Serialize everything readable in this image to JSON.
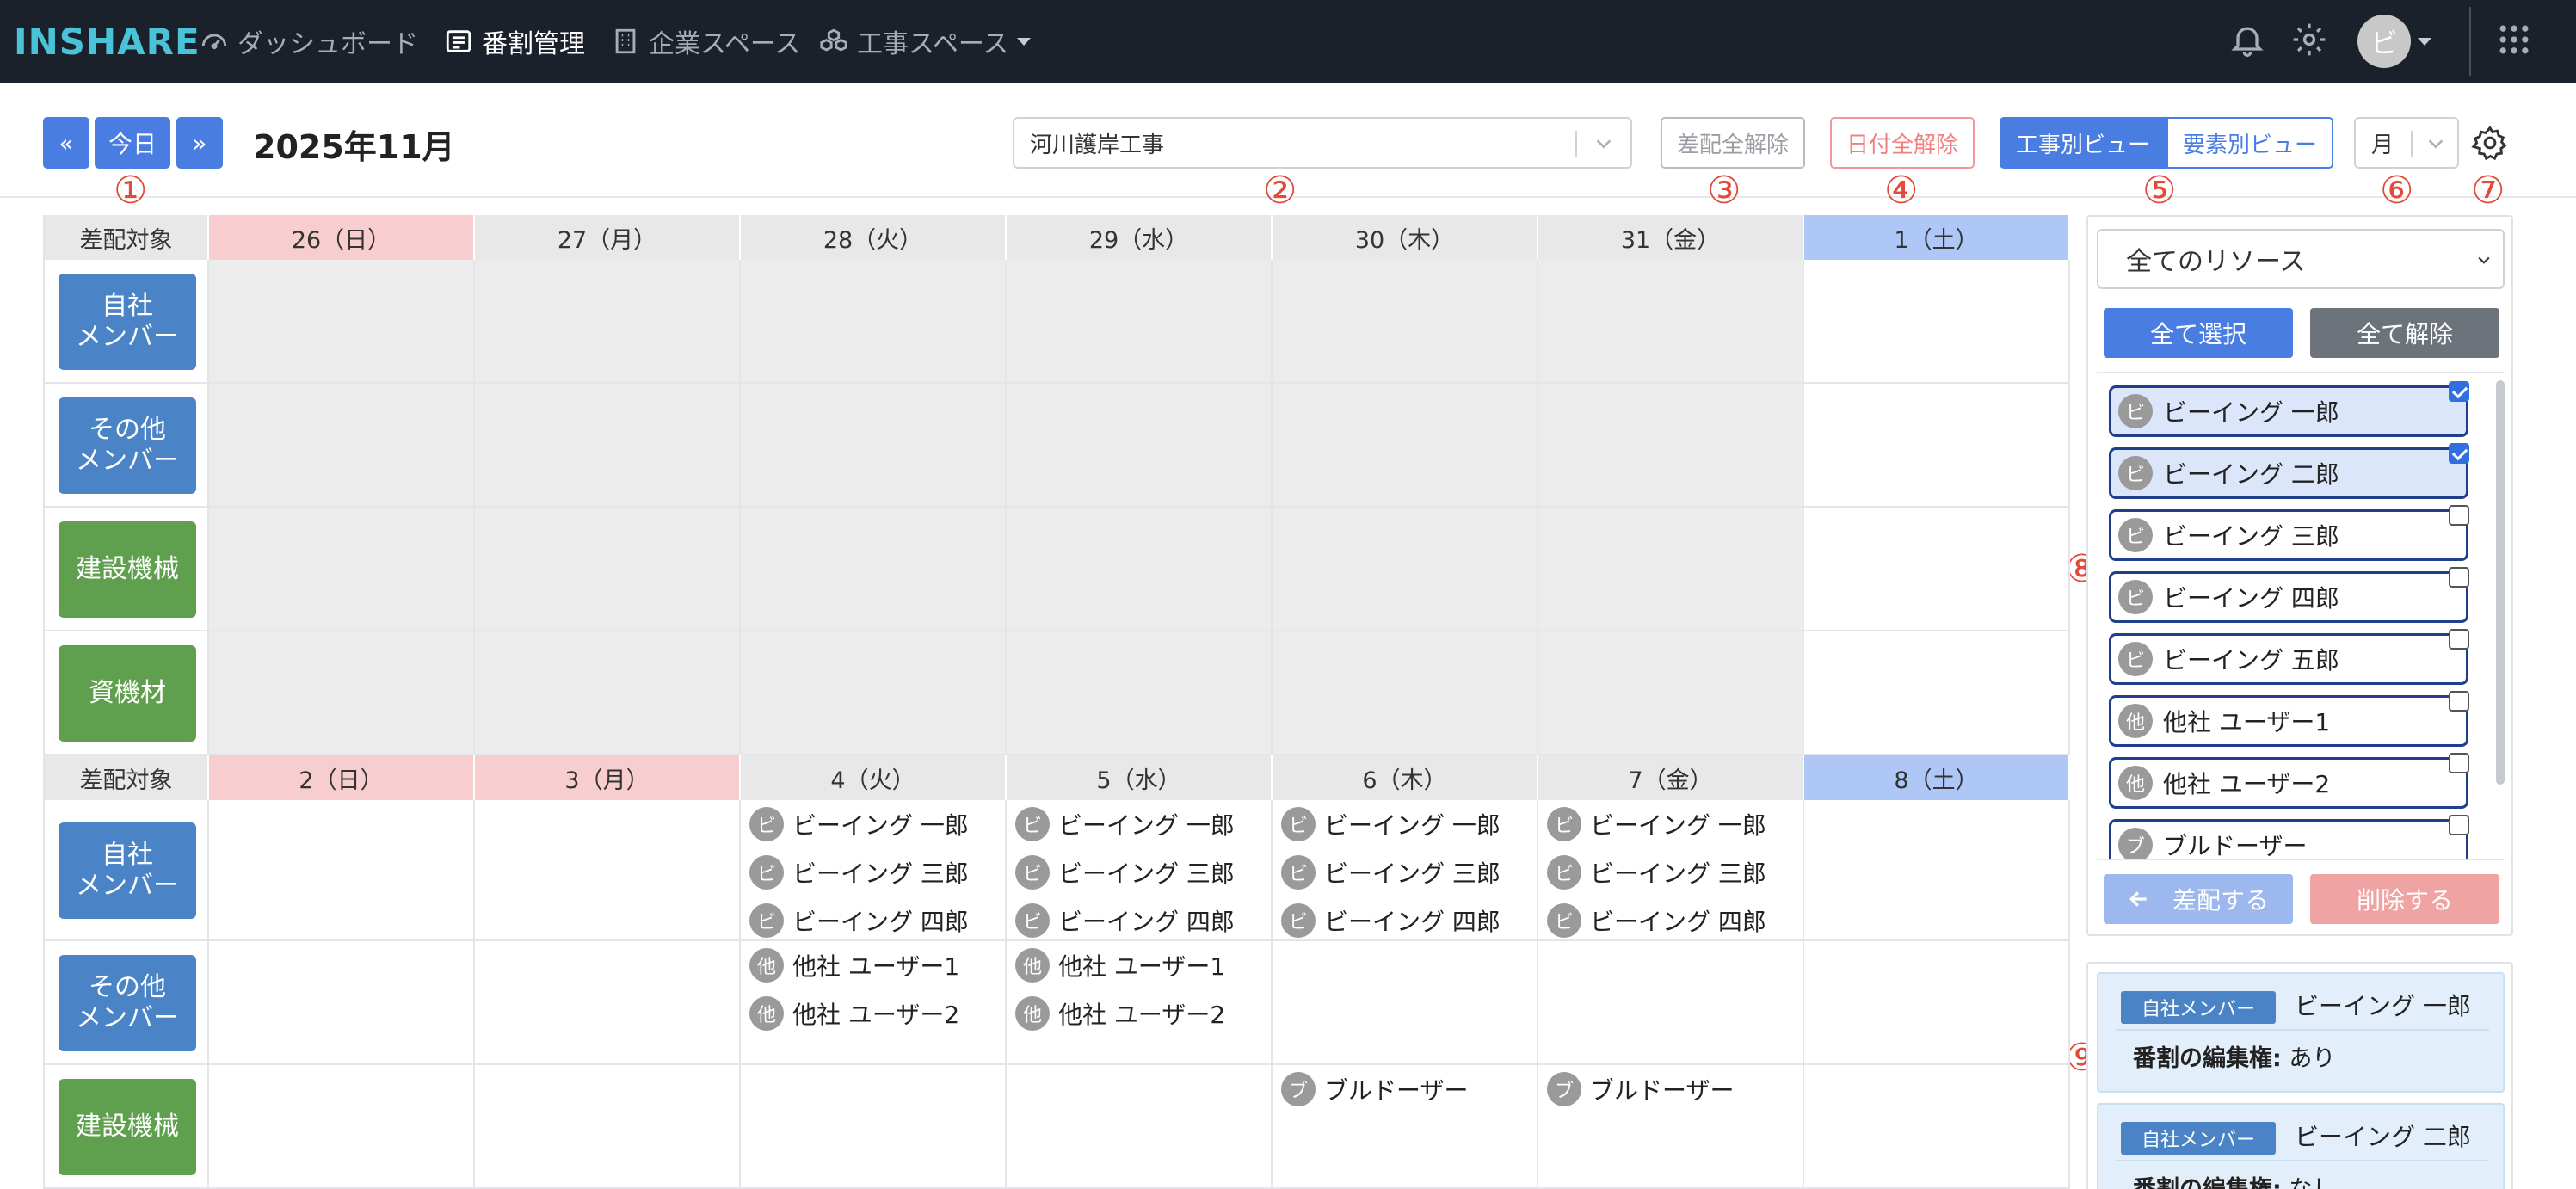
{
  "nav": {
    "logo": "INSHARE",
    "items": [
      {
        "label": "ダッシュボード"
      },
      {
        "label": "番割管理"
      },
      {
        "label": "企業スペース"
      },
      {
        "label": "工事スペース"
      }
    ],
    "avatar": "ビ"
  },
  "toolbar": {
    "prev": "«",
    "today": "今日",
    "next": "»",
    "month": "2025年11月",
    "project": "河川護岸工事",
    "clear_assign": "差配全解除",
    "clear_date": "日付全解除",
    "view_project": "工事別ビュー",
    "view_element": "要素別ビュー",
    "period": "月"
  },
  "markers": [
    "①",
    "②",
    "③",
    "④",
    "⑤",
    "⑥",
    "⑦",
    "⑧",
    "⑨"
  ],
  "calendar": {
    "row_header": "差配対象",
    "resources": {
      "own": "自社\nメンバー",
      "other": "その他\nメンバー",
      "machine": "建設機械",
      "material": "資機材"
    },
    "weeks": [
      {
        "days": [
          "26（日）",
          "27（月）",
          "28（火）",
          "29（水）",
          "30（木）",
          "31（金）",
          "1（土）"
        ],
        "cells": {
          "own": [
            [],
            [],
            [],
            [],
            [],
            [],
            []
          ],
          "other": [
            [],
            [],
            [],
            [],
            [],
            [],
            []
          ],
          "machine": [
            [],
            [],
            [],
            [],
            [],
            [],
            []
          ],
          "material": [
            [],
            [],
            [],
            [],
            [],
            [],
            []
          ]
        }
      },
      {
        "days": [
          "2（日）",
          "3（月）",
          "4（火）",
          "5（水）",
          "6（木）",
          "7（金）",
          "8（土）"
        ],
        "cells": {
          "own": [
            [],
            [],
            [
              {
                "av": "ビ",
                "name": "ビーイング 一郎"
              },
              {
                "av": "ビ",
                "name": "ビーイング 三郎"
              },
              {
                "av": "ビ",
                "name": "ビーイング 四郎"
              }
            ],
            [
              {
                "av": "ビ",
                "name": "ビーイング 一郎"
              },
              {
                "av": "ビ",
                "name": "ビーイング 三郎"
              },
              {
                "av": "ビ",
                "name": "ビーイング 四郎"
              }
            ],
            [
              {
                "av": "ビ",
                "name": "ビーイング 一郎"
              },
              {
                "av": "ビ",
                "name": "ビーイング 三郎"
              },
              {
                "av": "ビ",
                "name": "ビーイング 四郎"
              }
            ],
            [
              {
                "av": "ビ",
                "name": "ビーイング 一郎"
              },
              {
                "av": "ビ",
                "name": "ビーイング 三郎"
              },
              {
                "av": "ビ",
                "name": "ビーイング 四郎"
              }
            ],
            []
          ],
          "other": [
            [],
            [],
            [
              {
                "av": "他",
                "name": "他社 ユーザー1"
              },
              {
                "av": "他",
                "name": "他社 ユーザー2"
              }
            ],
            [
              {
                "av": "他",
                "name": "他社 ユーザー1"
              },
              {
                "av": "他",
                "name": "他社 ユーザー2"
              }
            ],
            [],
            [],
            []
          ],
          "machine": [
            [],
            [],
            [],
            [],
            [
              {
                "av": "ブ",
                "name": "ブルドーザー"
              }
            ],
            [
              {
                "av": "ブ",
                "name": "ブルドーザー"
              }
            ],
            []
          ]
        }
      }
    ]
  },
  "panel": {
    "filter": "全てのリソース",
    "select_all": "全て選択",
    "deselect_all": "全て解除",
    "items": [
      {
        "av": "ビ",
        "name": "ビーイング 一郎",
        "checked": true
      },
      {
        "av": "ビ",
        "name": "ビーイング 二郎",
        "checked": true
      },
      {
        "av": "ビ",
        "name": "ビーイング 三郎",
        "checked": false
      },
      {
        "av": "ビ",
        "name": "ビーイング 四郎",
        "checked": false
      },
      {
        "av": "ビ",
        "name": "ビーイング 五郎",
        "checked": false
      },
      {
        "av": "他",
        "name": "他社 ユーザー1",
        "checked": false
      },
      {
        "av": "他",
        "name": "他社 ユーザー2",
        "checked": false
      },
      {
        "av": "ブ",
        "name": "ブルドーザー",
        "checked": false
      }
    ],
    "assign": "差配する",
    "delete": "削除する"
  },
  "info": {
    "perm_label": "番割の編集権:",
    "cards": [
      {
        "badge": "自社メンバー",
        "name": "ビーイング 一郎",
        "perm": "あり"
      },
      {
        "badge": "自社メンバー",
        "name": "ビーイング 二郎",
        "perm": "なし"
      }
    ]
  },
  "colors": {
    "nav_bg": "#1b212b",
    "primary": "#4a7de2",
    "sunday": "#f8cdd0",
    "saturday": "#aec7f6",
    "own_member": "#4a84c7",
    "equipment": "#5fa04e",
    "marker": "#e24a3a"
  }
}
